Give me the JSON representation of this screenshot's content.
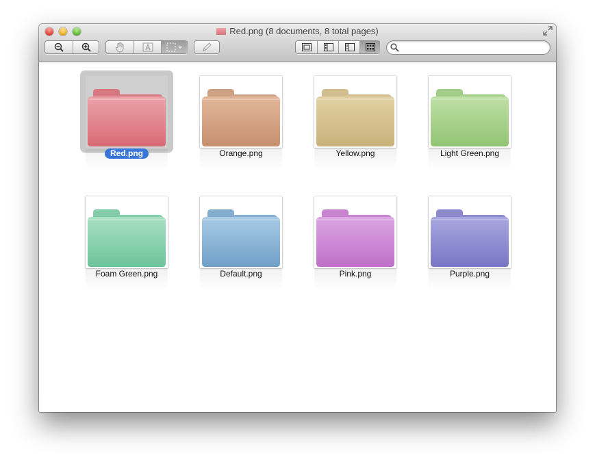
{
  "window": {
    "title": "Red.png (8 documents, 8 total pages)"
  },
  "toolbar": {
    "buttons": [
      {
        "name": "zoom-out-button",
        "icon": "zoom-out-icon"
      },
      {
        "name": "zoom-in-button",
        "icon": "zoom-in-icon"
      },
      {
        "name": "move-tool-button",
        "icon": "hand-icon"
      },
      {
        "name": "text-tool-button",
        "icon": "text-select-icon"
      },
      {
        "name": "rect-select-button",
        "icon": "marquee-select-icon"
      },
      {
        "name": "annotate-button",
        "icon": "pencil-icon"
      }
    ],
    "view_modes": [
      {
        "name": "view-content-only",
        "icon": "content-only-icon",
        "active": false
      },
      {
        "name": "view-thumbnails",
        "icon": "thumbnails-sidebar-icon",
        "active": false
      },
      {
        "name": "view-table-of-contents",
        "icon": "toc-sidebar-icon",
        "active": false
      },
      {
        "name": "view-contact-sheet",
        "icon": "contact-sheet-icon",
        "active": true
      }
    ],
    "search": {
      "placeholder": "",
      "value": ""
    }
  },
  "documents": [
    {
      "label": "Red.png",
      "color": "#d96a74",
      "light": "#eaa3aa",
      "selected": true
    },
    {
      "label": "Orange.png",
      "color": "#c7906f",
      "light": "#e2b79b",
      "selected": false
    },
    {
      "label": "Yellow.png",
      "color": "#c9b27a",
      "light": "#e2d1a4",
      "selected": false
    },
    {
      "label": "Light Green.png",
      "color": "#92c473",
      "light": "#bfe0a7",
      "selected": false
    },
    {
      "label": "Foam Green.png",
      "color": "#6cc39a",
      "light": "#a9e0c4",
      "selected": false
    },
    {
      "label": "Default.png",
      "color": "#6f9fc8",
      "light": "#a9cbe6",
      "selected": false
    },
    {
      "label": "Pink.png",
      "color": "#bf6fc9",
      "light": "#dca6e3",
      "selected": false
    },
    {
      "label": "Purple.png",
      "color": "#7876c4",
      "light": "#a9a8e0",
      "selected": false
    }
  ]
}
